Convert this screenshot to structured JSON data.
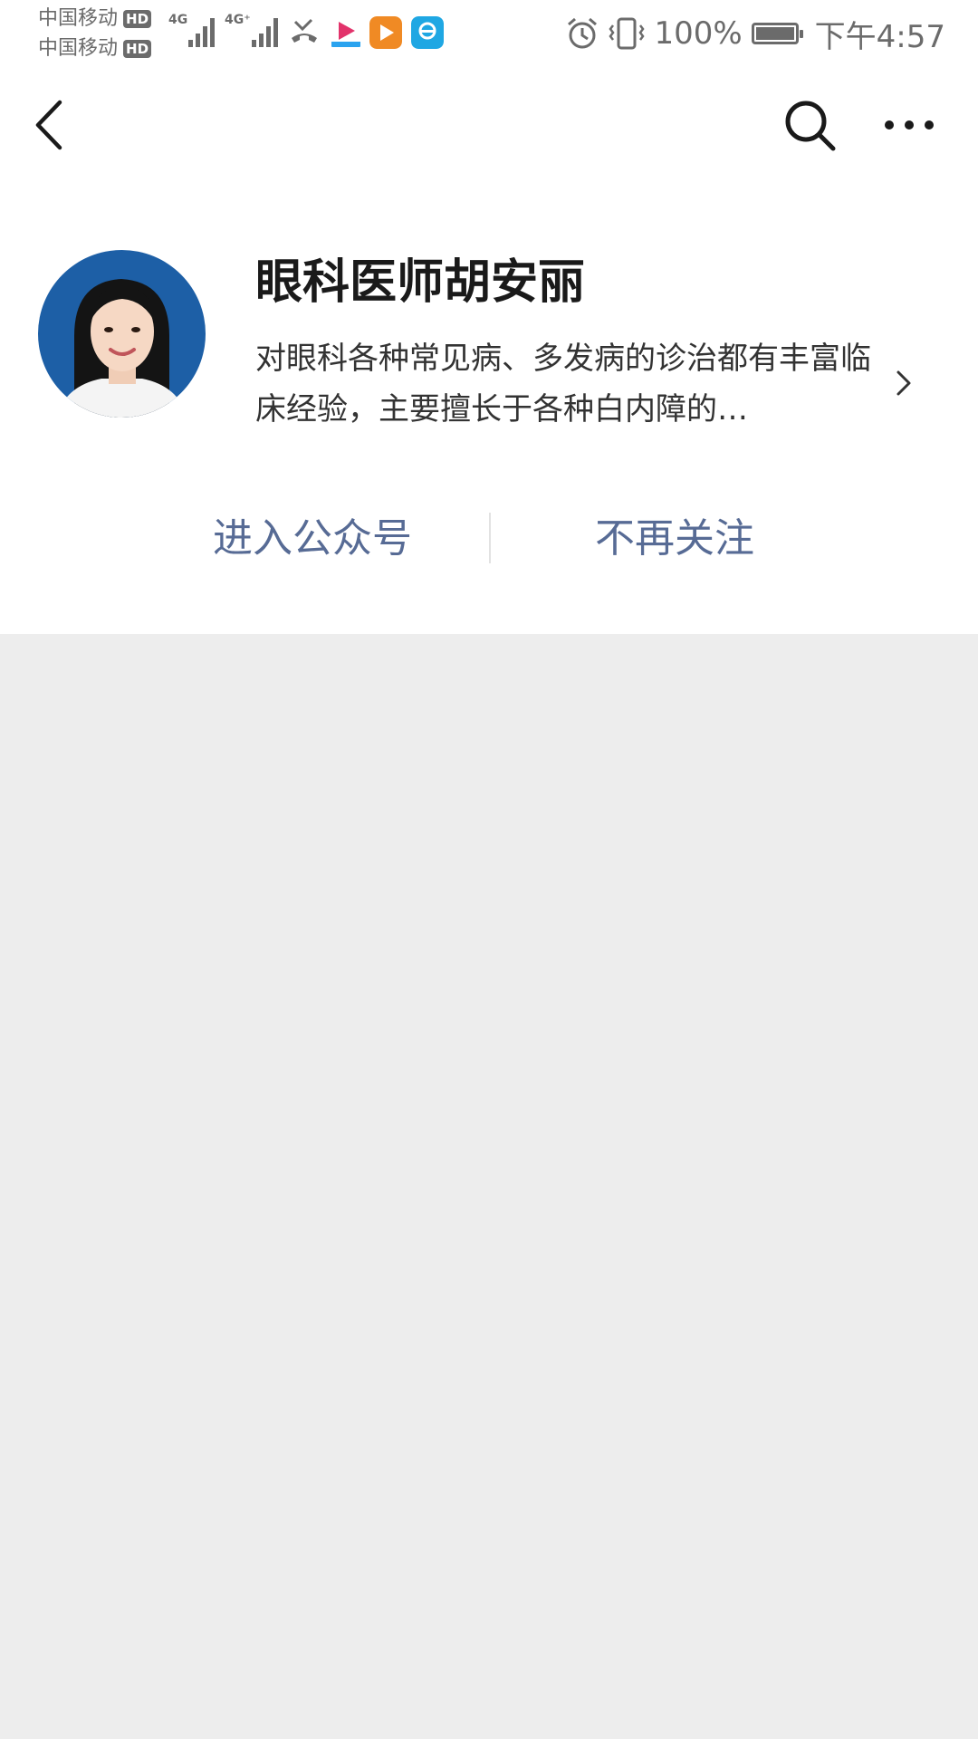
{
  "status_bar": {
    "carrier_1": "中国移动",
    "carrier_2": "中国移动",
    "hd": "HD",
    "network_1": "4G",
    "network_2": "4G⁺",
    "app_icons": [
      "missed-call-icon",
      "youku-icon",
      "video-app-icon",
      "browser-app-icon"
    ],
    "alarm_icon": "alarm-icon",
    "vibrate_icon": "vibrate-icon",
    "battery": "100%",
    "time": "下午4:57"
  },
  "nav": {
    "back_icon": "back-chevron-icon",
    "search_icon": "search-icon",
    "more_icon": "more-dots-icon"
  },
  "profile": {
    "name": "眼科医师胡安丽",
    "description": "对眼科各种常见病、多发病的诊治都有丰富临床经验，主要擅长于各种白内障的…",
    "avatar_icon": "avatar-photo"
  },
  "actions": {
    "enter_label": "进入公众号",
    "unfollow_label": "不再关注"
  },
  "colors": {
    "link": "#576b95",
    "page_bg": "#ededed",
    "card_bg": "#ffffff",
    "avatar_bg": "#1d5fa6"
  }
}
